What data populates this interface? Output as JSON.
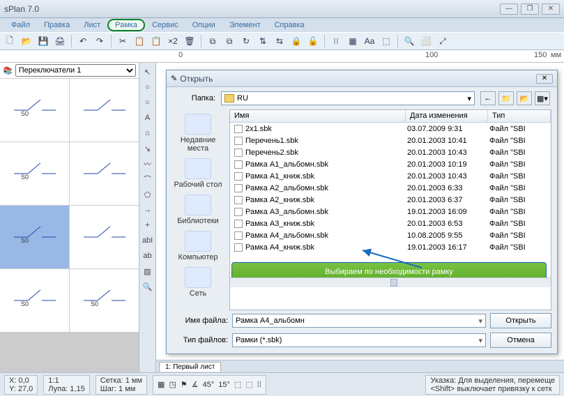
{
  "window": {
    "title": "sPlan 7.0"
  },
  "menu": [
    "Файл",
    "Правка",
    "Лист",
    "Рамка",
    "Сервис",
    "Опции",
    "Элемент",
    "Справка"
  ],
  "menu_highlight": 3,
  "ruler": {
    "tick1": "0",
    "tick2": "100",
    "tick3": "150",
    "unit": "мм"
  },
  "librarySelect": "Переключатели 1",
  "vtools": [
    "↖",
    "○",
    "○",
    "A",
    "⌂",
    "↘",
    "〰",
    "⌒",
    "⬠",
    "→",
    "+",
    "abI",
    "ab",
    "▨",
    "🔍"
  ],
  "cells": [
    "S0",
    "",
    "S0",
    "",
    "S0",
    "",
    "S0",
    "S0"
  ],
  "cell_highlight": 4,
  "toolbar_icons": [
    "🗋",
    "📂",
    "💾",
    "🖨",
    "",
    "↶",
    "↷",
    "",
    "✂",
    "📋",
    "📋",
    "×2",
    "🗑",
    "",
    "⧉",
    "⧉",
    "↻",
    "⇅",
    "⇆",
    "🔒",
    "🔓",
    "",
    "⁝⁝",
    "▦",
    "Aa",
    "⬚",
    "",
    "🔍",
    "⬜",
    "⤢"
  ],
  "tab": "1: Первый лист",
  "status": {
    "coords": "X: 0,0\nY: 27,0",
    "scale": "1:1\nЛупа: 1,15",
    "grid": "Сетка: 1 мм\nШаг: 1 мм",
    "tip": "Указка: Для выделения, перемеще\n<Shift> выключает привязку к сетк"
  },
  "status_icons": [
    "▦",
    "◳",
    "⚑",
    "∡",
    "45°",
    "15°",
    "⬚",
    "⬚",
    "⁞⁞"
  ],
  "dialog": {
    "title": "Открыть",
    "folderLabel": "Папка:",
    "folder": "RU",
    "places": [
      "Недавние места",
      "Рабочий стол",
      "Библиотеки",
      "Компьютер",
      "Сеть"
    ],
    "cols": {
      "name": "Имя",
      "date": "Дата изменения",
      "type": "Тип"
    },
    "files": [
      {
        "n": "2x1.sbk",
        "d": "03.07.2009 9:31",
        "t": "Файл \"SBI"
      },
      {
        "n": "Перечень1.sbk",
        "d": "20.01.2003 10:41",
        "t": "Файл \"SBI"
      },
      {
        "n": "Перечень2.sbk",
        "d": "20.01.2003 10:43",
        "t": "Файл \"SBI"
      },
      {
        "n": "Рамка А1_альбомн.sbk",
        "d": "20.01.2003 10:19",
        "t": "Файл \"SBI"
      },
      {
        "n": "Рамка А1_книж.sbk",
        "d": "20.01.2003 10:43",
        "t": "Файл \"SBI"
      },
      {
        "n": "Рамка А2_альбомн.sbk",
        "d": "20.01.2003 6:33",
        "t": "Файл \"SBI"
      },
      {
        "n": "Рамка А2_книж.sbk",
        "d": "20.01.2003 6:37",
        "t": "Файл \"SBI"
      },
      {
        "n": "Рамка А3_альбомн.sbk",
        "d": "19.01.2003 16:09",
        "t": "Файл \"SBI"
      },
      {
        "n": "Рамка А3_книж.sbk",
        "d": "20.01.2003 6:53",
        "t": "Файл \"SBI"
      },
      {
        "n": "Рамка А4_альбомн.sbk",
        "d": "10.08.2005 9:55",
        "t": "Файл \"SBI"
      },
      {
        "n": "Рамка А4_книж.sbk",
        "d": "19.01.2003 16:17",
        "t": "Файл \"SBI"
      }
    ],
    "callout": "Выбираем по необходимости рамку",
    "filenameLabel": "Имя файла:",
    "filename": "Рамка А4_альбомн",
    "typeLabel": "Тип файлов:",
    "type": "Рамки (*.sbk)",
    "open": "Открыть",
    "cancel": "Отмена"
  }
}
